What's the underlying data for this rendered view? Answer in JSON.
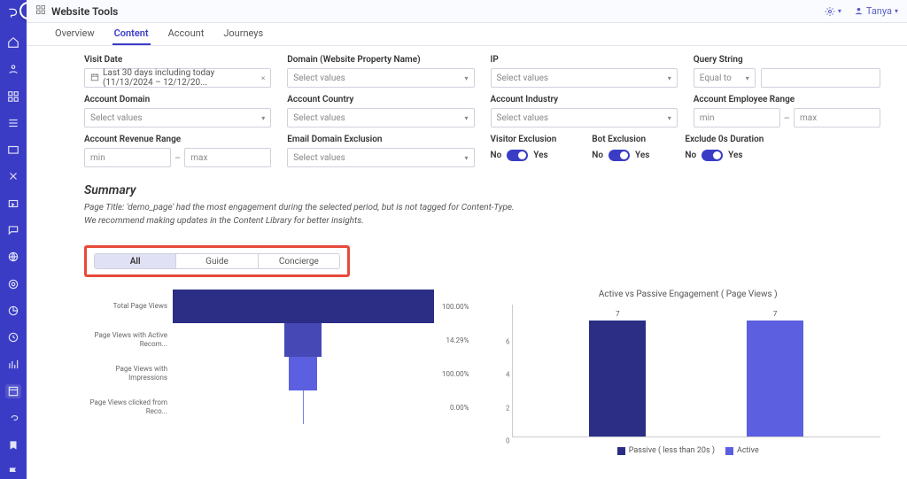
{
  "header": {
    "page_title": "Website Tools",
    "settings_label": "",
    "user_name": "Tanya"
  },
  "tabs": [
    "Overview",
    "Content",
    "Account",
    "Journeys"
  ],
  "active_tab": "Content",
  "filters": {
    "visit_date": {
      "label": "Visit Date",
      "value": "Last 30 days including today (11/13/2024 – 12/12/20..."
    },
    "domain": {
      "label": "Domain (Website Property Name)",
      "placeholder": "Select values"
    },
    "ip": {
      "label": "IP",
      "placeholder": "Select values"
    },
    "query_string": {
      "label": "Query String",
      "op": "Equal to",
      "value": ""
    },
    "account_domain": {
      "label": "Account Domain",
      "placeholder": "Select values"
    },
    "account_country": {
      "label": "Account Country",
      "placeholder": "Select values"
    },
    "account_industry": {
      "label": "Account Industry",
      "placeholder": "Select values"
    },
    "account_employee_range": {
      "label": "Account Employee Range",
      "min": "min",
      "max": "max"
    },
    "account_revenue_range": {
      "label": "Account Revenue Range",
      "min": "min",
      "max": "max"
    },
    "email_domain_exclusion": {
      "label": "Email Domain Exclusion",
      "placeholder": "Select values"
    },
    "visitor_exclusion": {
      "label": "Visitor Exclusion",
      "no": "No",
      "yes": "Yes"
    },
    "bot_exclusion": {
      "label": "Bot Exclusion",
      "no": "No",
      "yes": "Yes"
    },
    "exclude_0s": {
      "label": "Exclude 0s Duration",
      "no": "No",
      "yes": "Yes"
    }
  },
  "summary": {
    "heading": "Summary",
    "line1": "Page Title: 'demo_page' had the most engagement during the selected period, but is not tagged for Content-Type.",
    "line2": "We recommend making updates in the Content Library for better insights."
  },
  "segmented": {
    "options": [
      "All",
      "Guide",
      "Concierge"
    ],
    "active": "All"
  },
  "chart_data": [
    {
      "type": "bar",
      "orientation": "horizontal-funnel",
      "title": "",
      "categories": [
        "Total Page Views",
        "Page Views with Active Recom...",
        "Page Views with Impressions",
        "Page Views clicked from Reco..."
      ],
      "values_pct": [
        100.0,
        14.29,
        100.0,
        0.0
      ],
      "value_labels": [
        "100.00%",
        "14.29%",
        "100.00%",
        "0.00%"
      ],
      "colors": [
        "#2b2e84",
        "#4548b5",
        "#5b5fe0",
        "#7a7dea"
      ]
    },
    {
      "type": "bar",
      "title": "Active vs Passive Engagement ( Page Views )",
      "categories": [
        "Passive ( less than 20s )",
        "Active"
      ],
      "values": [
        7,
        7
      ],
      "ylim": [
        0,
        8
      ],
      "yticks": [
        0,
        2,
        4,
        6
      ],
      "colors": [
        "#2b2e84",
        "#5b5fe0"
      ],
      "legend": [
        "Passive ( less than 20s )",
        "Active"
      ]
    }
  ],
  "colors": {
    "brand": "#3a3cc6",
    "highlight_box": "#e84a3a",
    "funnel": [
      "#2b2e84",
      "#4548b5",
      "#5b5fe0",
      "#7a7dea"
    ]
  }
}
